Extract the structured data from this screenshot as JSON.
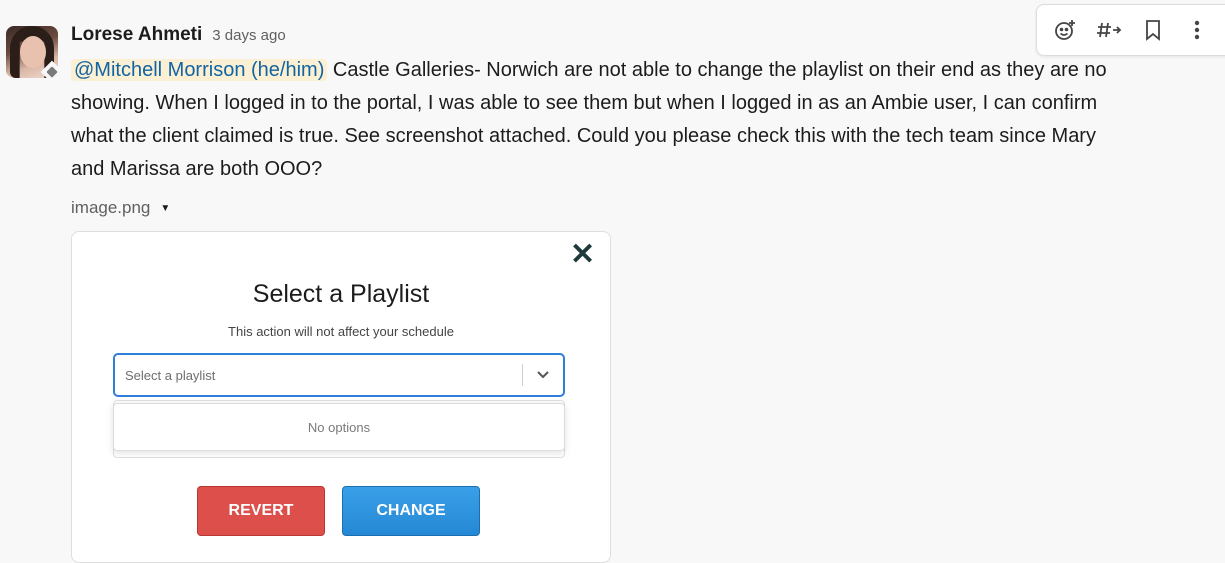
{
  "message": {
    "author": "Lorese Ahmeti",
    "timestamp": "3 days ago",
    "mention": "@Mitchell Morrison (he/him)",
    "line1_rest": " Castle Galleries-  Norwich are not able to change the playlist on their end as they are no",
    "line2": "showing. When I logged in to the portal, I was able to see them but when I logged in as an Ambie user, I can confirm",
    "line3": "what the client claimed is true. See screenshot attached. Could you please check this with the tech team since Mary",
    "line4": "and Marissa are both OOO?"
  },
  "actions": {
    "icons": [
      "add-reaction-icon",
      "reply-in-thread-icon",
      "bookmark-icon",
      "more-actions-icon"
    ]
  },
  "attachment": {
    "filename": "image.png",
    "modal": {
      "title": "Select a Playlist",
      "subtitle": "This action will not affect your schedule",
      "select_placeholder": "Select a playlist",
      "dropdown_text": "No options",
      "revert_label": "REVERT",
      "change_label": "CHANGE"
    }
  },
  "colors": {
    "mention_bg": "#fbf0d4",
    "mention_text": "#1264a3",
    "revert_bg": "#dd4f4b",
    "change_bg": "#2588d4",
    "select_border": "#2f7fd8"
  }
}
